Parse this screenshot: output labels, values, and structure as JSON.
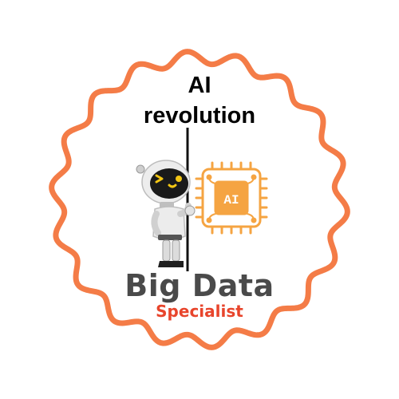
{
  "badge": {
    "title_line1": "AI",
    "title_line2": "revolution",
    "chip_label": "AI",
    "brand_main": "Big Data",
    "brand_sub": "Specialist"
  },
  "colors": {
    "badge_ring": "#f47c47",
    "chip": "#f5a442",
    "brand_sub": "#e8452c",
    "brand_main": "#4a4a4a",
    "robot_visor": "#1a1a1a",
    "robot_eyes": "#f3c614",
    "robot_body": "#e6e6e6"
  },
  "icons": {
    "robot": "robot-mascot-icon",
    "chip": "ai-chip-icon"
  }
}
